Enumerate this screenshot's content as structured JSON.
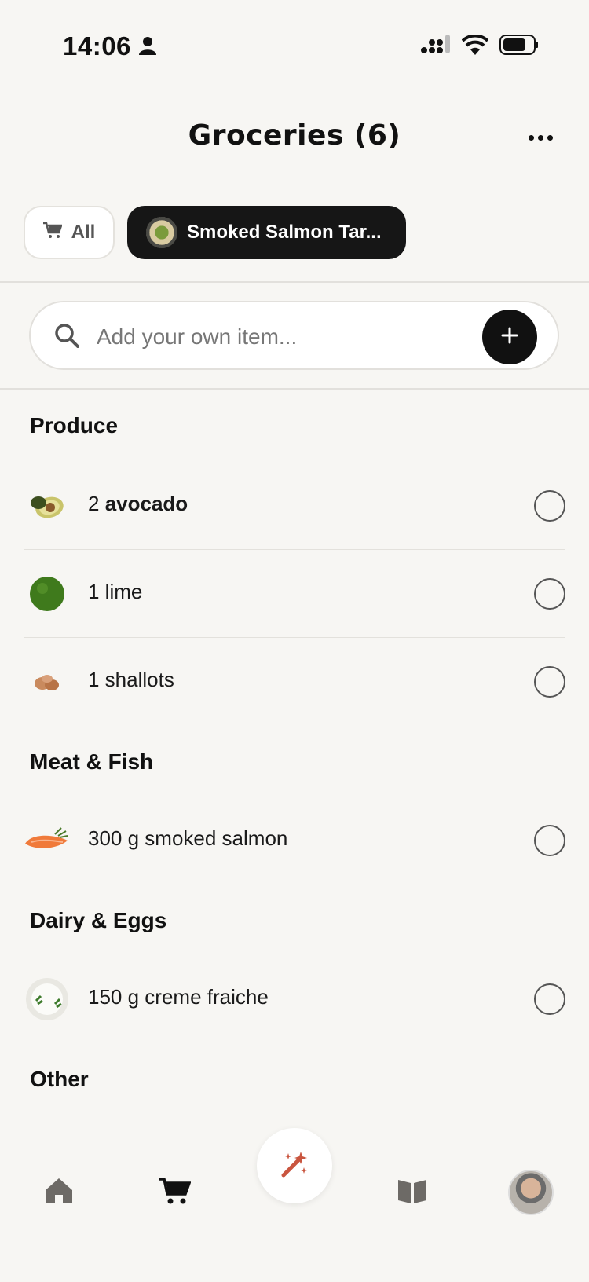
{
  "status_bar": {
    "time": "14:06"
  },
  "header": {
    "title": "Groceries (6)"
  },
  "filters": {
    "all_label": "All",
    "recipe_label": "Smoked Salmon Tar..."
  },
  "search": {
    "placeholder": "Add your own item..."
  },
  "sections": [
    {
      "title": "Produce",
      "items": [
        {
          "qty": "2",
          "name": "avocado",
          "icon": "avocado-icon"
        },
        {
          "text": "1 lime",
          "icon": "lime-icon"
        },
        {
          "text": "1 shallots",
          "icon": "shallot-icon"
        }
      ]
    },
    {
      "title": "Meat & Fish",
      "items": [
        {
          "text": "300 g smoked salmon",
          "icon": "salmon-icon"
        }
      ]
    },
    {
      "title": "Dairy & Eggs",
      "items": [
        {
          "text": "150 g creme fraiche",
          "icon": "creme-fraiche-icon"
        }
      ]
    },
    {
      "title": "Other",
      "items": []
    }
  ],
  "colors": {
    "accent": "#c9553f",
    "chip_dark": "#161616",
    "background": "#f7f6f3"
  }
}
